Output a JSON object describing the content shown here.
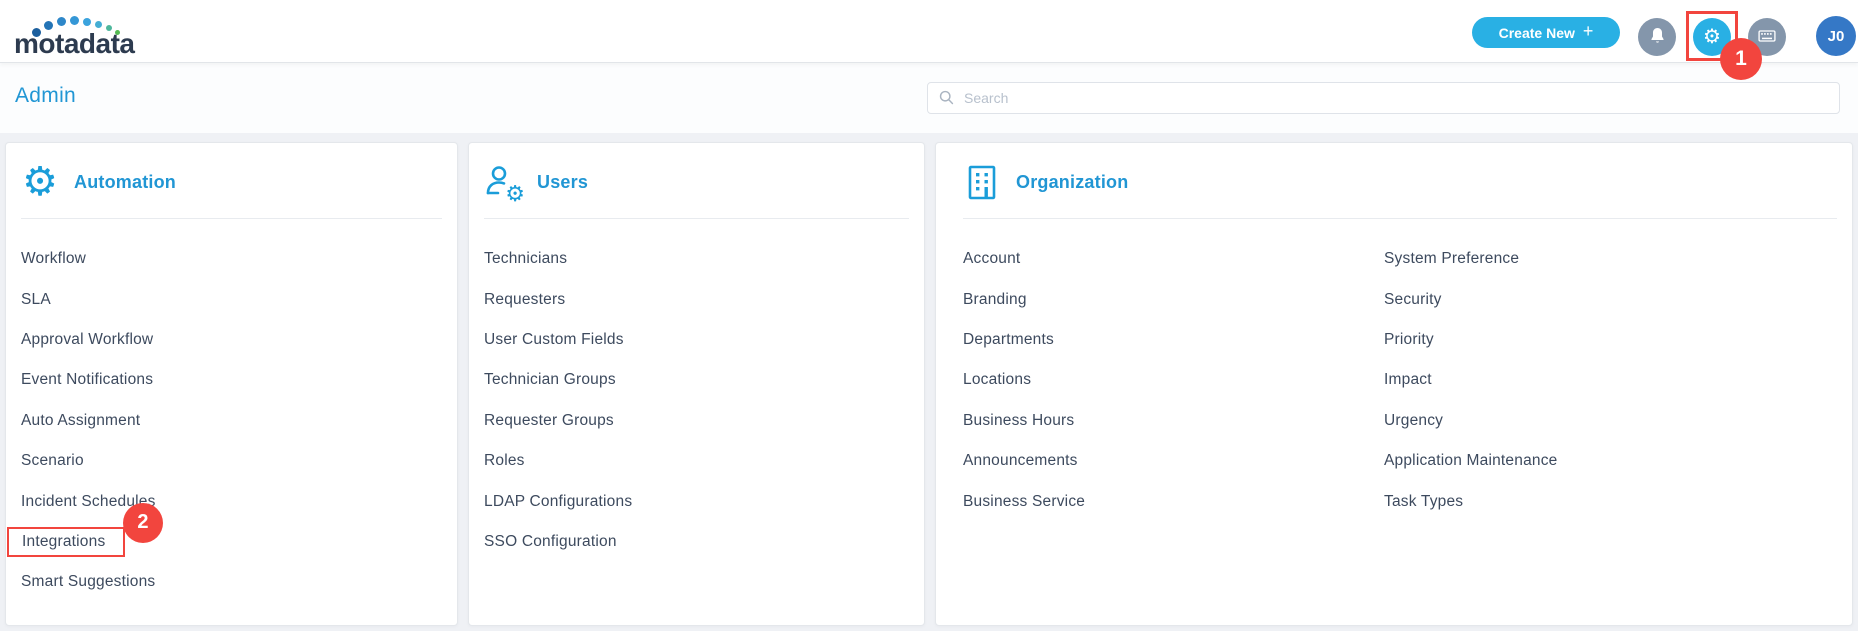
{
  "topbar": {
    "logo_text": "motadata",
    "create_new_label": "Create New",
    "avatar_text": "J0"
  },
  "icons": {
    "plus": "+",
    "gear": "⚙"
  },
  "header": {
    "title": "Admin",
    "search_placeholder": "Search"
  },
  "annotations": {
    "step1": "1",
    "step2": "2"
  },
  "colors": {
    "accent_cyan": "#29b0e4",
    "title_blue": "#2196d4",
    "icon_gray_blue": "#8496ab",
    "avatar_blue": "#3578c6",
    "annotation_red": "#f2453e",
    "item_text": "#3d4a5e",
    "page_bg": "#eff1f5"
  },
  "cards": [
    {
      "title": "Automation",
      "icon": "automation-gear-icon",
      "items": [
        "Workflow",
        "SLA",
        "Approval Workflow",
        "Event Notifications",
        "Auto Assignment",
        "Scenario",
        "Incident Schedules",
        "Integrations",
        "Smart Suggestions"
      ],
      "highlight": {
        "item": "Integrations",
        "badge": "2"
      }
    },
    {
      "title": "Users",
      "icon": "user-gear-icon",
      "items": [
        "Technicians",
        "Requesters",
        "User Custom Fields",
        "Technician Groups",
        "Requester Groups",
        "Roles",
        "LDAP Configurations",
        "SSO Configuration"
      ]
    },
    {
      "title": "Organization",
      "icon": "building-icon",
      "items_col1": [
        "Account",
        "Branding",
        "Departments",
        "Locations",
        "Business Hours",
        "Announcements",
        "Business Service"
      ],
      "items_col2": [
        "System Preference",
        "Security",
        "Priority",
        "Impact",
        "Urgency",
        "Application Maintenance",
        "Task Types"
      ]
    }
  ]
}
